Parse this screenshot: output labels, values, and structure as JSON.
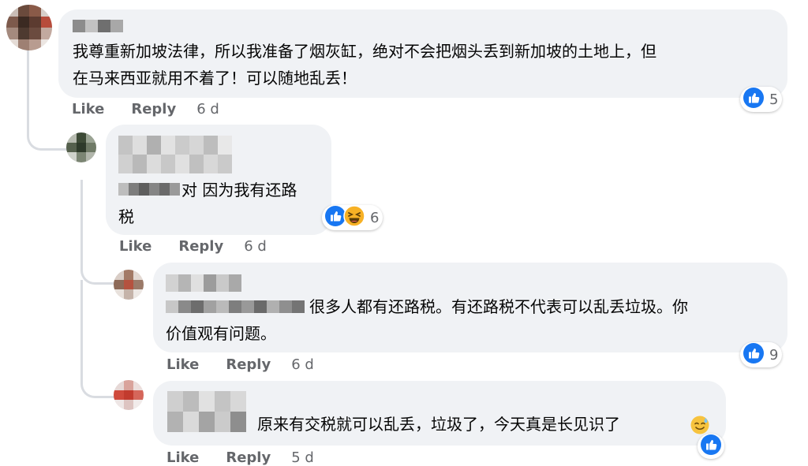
{
  "comments": [
    {
      "text_lines": [
        "我尊重新加坡法律，所以我准备了烟灰缸，绝对不会把烟头丢到新加坡的土地上，但",
        "在马来西亚就用不着了！可以随地乱丢！"
      ],
      "like_label": "Like",
      "reply_label": "Reply",
      "time": "6 d",
      "reaction_count": "5"
    },
    {
      "text_lines": [
        "对 因为我有还路",
        "税"
      ],
      "like_label": "Like",
      "reply_label": "Reply",
      "time": "6 d",
      "reaction_count": "6"
    },
    {
      "text_lines": [
        "很多人都有还路税。有还路税不代表可以乱丢垃圾。你",
        "价值观有问题。"
      ],
      "like_label": "Like",
      "reply_label": "Reply",
      "time": "6 d",
      "reaction_count": "9"
    },
    {
      "text_lines": [
        "原来有交税就可以乱丢，垃圾了，今天真是长见识了"
      ],
      "like_label": "Like",
      "reply_label": "Reply",
      "time": "5 d",
      "reaction_count": ""
    }
  ],
  "colors": {
    "bubble": "#f0f2f5",
    "like_blue": "#1877f2",
    "haha_yellow": "#f7b125",
    "secondary_text": "#65676b"
  },
  "icons": [
    "thumbs-up-icon",
    "haha-emoji-icon",
    "sweat-smile-emoji-icon"
  ]
}
